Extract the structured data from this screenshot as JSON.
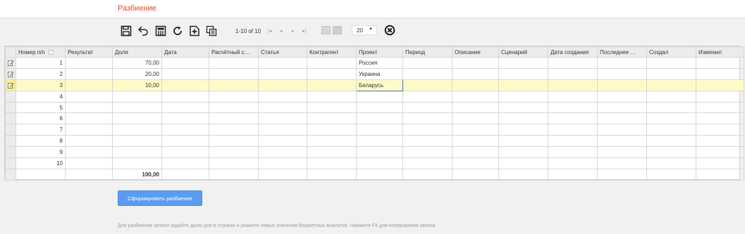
{
  "page": {
    "title": "Разбиение"
  },
  "toolbar": {
    "icons": [
      "save-icon",
      "undo-icon",
      "calculator-icon",
      "refresh-icon",
      "add-row-icon",
      "copy-icon"
    ],
    "pager_label": "1-10 of 10",
    "pager_buttons": [
      "|◂",
      "◂",
      "▸",
      "▸|"
    ],
    "page_size": "20",
    "close_icon": "close-icon"
  },
  "grid": {
    "columns": [
      "Номер п/п",
      "Результат",
      "Доля",
      "Дата",
      "Расчётный с…",
      "Статья",
      "Контрагент",
      "Проект",
      "Период",
      "Описание",
      "Сценарий",
      "Дата создания",
      "Последнее …",
      "Создал",
      "Изменил"
    ],
    "rows": [
      {
        "num": "1",
        "dolya": "70,00",
        "proekt": "Россия",
        "edit": true
      },
      {
        "num": "2",
        "dolya": "20,00",
        "proekt": "Украина",
        "edit": true
      },
      {
        "num": "3",
        "dolya": "10,00",
        "proekt": "Беларусь",
        "edit": true,
        "selected": true
      },
      {
        "num": "4",
        "dolya": "",
        "proekt": "",
        "edit": false
      },
      {
        "num": "5",
        "dolya": "",
        "proekt": "",
        "edit": false
      },
      {
        "num": "6",
        "dolya": "",
        "proekt": "",
        "edit": false
      },
      {
        "num": "7",
        "dolya": "",
        "proekt": "",
        "edit": false
      },
      {
        "num": "8",
        "dolya": "",
        "proekt": "",
        "edit": false
      },
      {
        "num": "9",
        "dolya": "",
        "proekt": "",
        "edit": false
      },
      {
        "num": "10",
        "dolya": "",
        "proekt": "",
        "edit": false
      }
    ],
    "total": "100,00"
  },
  "actions": {
    "split_button": "Сформировать разбиение"
  },
  "hint": "Для разбиения записи задайте долю для в строках и укажите новые значения бюджетных аналитик. Нажмите F4 для копирования записи",
  "colors": {
    "title": "#e8442c",
    "button": "#5b9cf0",
    "selected_row": "#fffbc9",
    "active_border": "#4470b8"
  }
}
